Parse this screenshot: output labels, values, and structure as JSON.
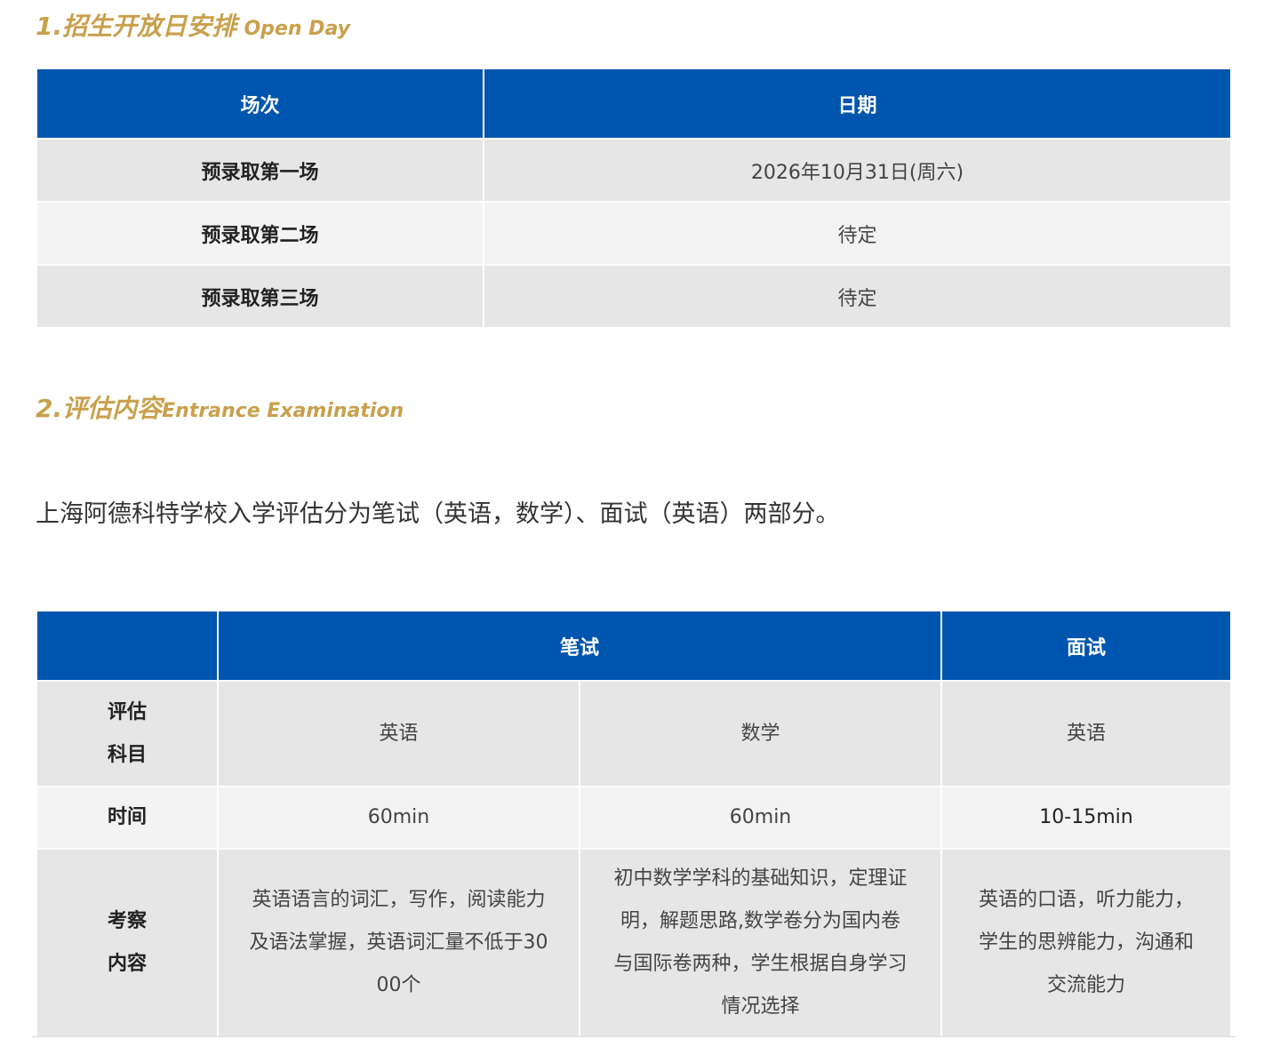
{
  "section1": {
    "title_zh": "1.招生开放日安排",
    "title_en": "Open Day"
  },
  "openday_table": {
    "headers": [
      "场次",
      "日期"
    ],
    "rows": [
      {
        "session": "预录取第一场",
        "date": "2026年10月31日(周六)"
      },
      {
        "session": "预录取第二场",
        "date": "待定"
      },
      {
        "session": "预录取第三场",
        "date": "待定"
      }
    ]
  },
  "section2": {
    "title_zh": "2.评估内容",
    "title_en": "Entrance Examination"
  },
  "intro_text": "上海阿德科特学校入学评估分为笔试（英语，数学）、面试（英语）两部分。",
  "exam_table": {
    "headers": {
      "corner": "",
      "written": "笔试",
      "interview": "面试"
    },
    "subject_row": {
      "label_line1": "评估",
      "label_line2": "科目",
      "english": "英语",
      "math": "数学",
      "interview_english": "英语"
    },
    "time_row": {
      "label": "时间",
      "english": "60min",
      "math": "60min",
      "interview": "10-15min"
    },
    "content_row": {
      "label_line1": "考察",
      "label_line2": "内容",
      "english": [
        "英语语言的词汇，写作，阅读能力",
        "及语法掌握，英语词汇量不低于30",
        "00个"
      ],
      "math": [
        "初中数学学科的基础知识，定理证",
        "明，解题思路,数学卷分为国内卷",
        "与国际卷两种，学生根据自身学习",
        "情况选择"
      ],
      "interview": [
        "英语的口语，听力能力，",
        "学生的思辨能力，沟通和",
        "交流能力"
      ]
    }
  }
}
